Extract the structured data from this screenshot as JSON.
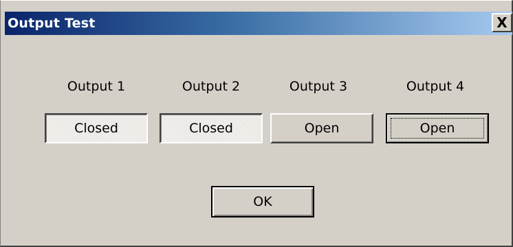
{
  "window": {
    "title": "Output Test",
    "close_label": "X"
  },
  "outputs": [
    {
      "label": "Output 1",
      "state": "Closed",
      "pressed": true
    },
    {
      "label": "Output 2",
      "state": "Closed",
      "pressed": true
    },
    {
      "label": "Output 3",
      "state": "Open",
      "pressed": false
    },
    {
      "label": "Output 4",
      "state": "Open",
      "pressed": false,
      "focused": true
    }
  ],
  "ok_label": "OK",
  "colors": {
    "face": "#d4d0c8",
    "title_start": "#0a246a",
    "title_end": "#a6caf0"
  }
}
